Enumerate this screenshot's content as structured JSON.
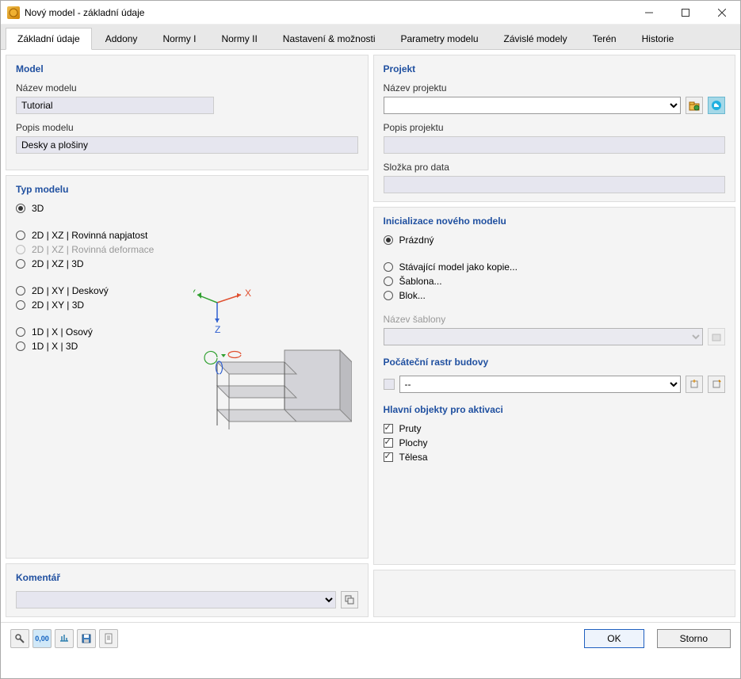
{
  "window": {
    "title": "Nový model - základní údaje"
  },
  "tabs": [
    "Základní údaje",
    "Addony",
    "Normy I",
    "Normy II",
    "Nastavení & možnosti",
    "Parametry modelu",
    "Závislé modely",
    "Terén",
    "Historie"
  ],
  "active_tab": 0,
  "model_section": {
    "title": "Model",
    "name_label": "Název modelu",
    "name_value": "Tutorial",
    "desc_label": "Popis modelu",
    "desc_value": "Desky a plošiny"
  },
  "type_section": {
    "title": "Typ modelu",
    "options": [
      {
        "label": "3D",
        "checked": true,
        "disabled": false
      },
      {
        "spacer": true
      },
      {
        "label": "2D | XZ | Rovinná napjatost",
        "checked": false,
        "disabled": false
      },
      {
        "label": "2D | XZ | Rovinná deformace",
        "checked": false,
        "disabled": true
      },
      {
        "label": "2D | XZ | 3D",
        "checked": false,
        "disabled": false
      },
      {
        "spacer": true
      },
      {
        "label": "2D | XY | Deskový",
        "checked": false,
        "disabled": false
      },
      {
        "label": "2D | XY | 3D",
        "checked": false,
        "disabled": false
      },
      {
        "spacer": true
      },
      {
        "label": "1D | X | Osový",
        "checked": false,
        "disabled": false
      },
      {
        "label": "1D | X | 3D",
        "checked": false,
        "disabled": false
      }
    ]
  },
  "project_section": {
    "title": "Projekt",
    "name_label": "Název projektu",
    "name_value": "",
    "desc_label": "Popis projektu",
    "desc_value": "",
    "folder_label": "Složka pro data",
    "folder_value": ""
  },
  "init_section": {
    "title": "Inicializace nového modelu",
    "options": [
      {
        "label": "Prázdný",
        "checked": true
      },
      {
        "spacer": true
      },
      {
        "label": "Stávající model jako kopie...",
        "checked": false
      },
      {
        "label": "Šablona...",
        "checked": false
      },
      {
        "label": "Blok...",
        "checked": false
      }
    ],
    "template_label": "Název šablony",
    "template_value": ""
  },
  "raster_section": {
    "title": "Počáteční rastr budovy",
    "value": "--"
  },
  "activate_section": {
    "title": "Hlavní objekty pro aktivaci",
    "options": [
      {
        "label": "Pruty",
        "checked": true
      },
      {
        "label": "Plochy",
        "checked": true
      },
      {
        "label": "Tělesa",
        "checked": true
      }
    ]
  },
  "comment_section": {
    "title": "Komentář",
    "value": ""
  },
  "buttons": {
    "ok": "OK",
    "cancel": "Storno"
  },
  "colors": {
    "panel_title": "#2050a0",
    "primary_button_border": "#2060c0"
  }
}
